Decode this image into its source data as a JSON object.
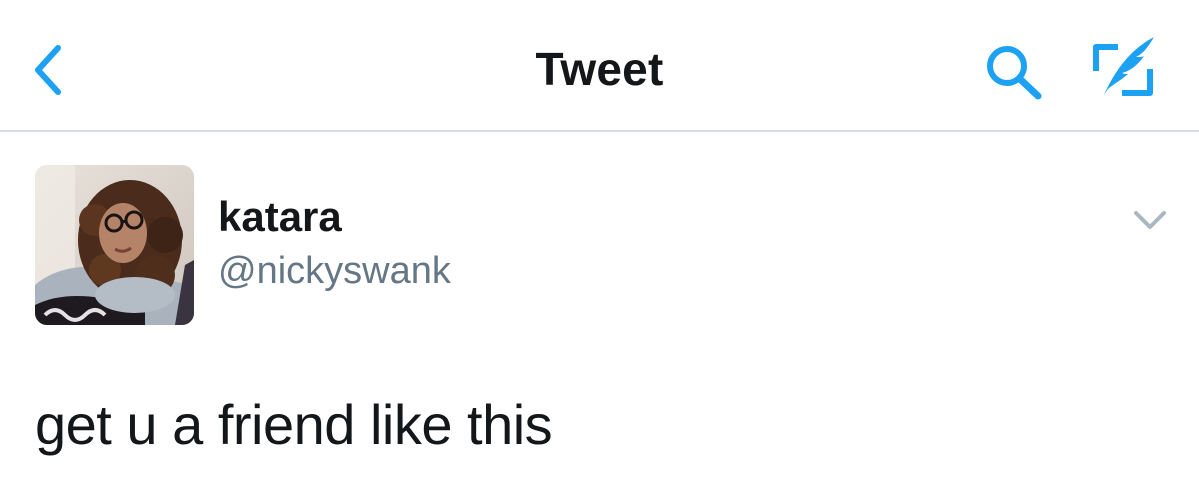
{
  "navbar": {
    "title": "Tweet",
    "back_icon": "chevron-left-icon",
    "search_icon": "search-icon",
    "compose_icon": "compose-tweet-icon"
  },
  "tweet": {
    "author": {
      "display_name": "katara",
      "handle": "@nickyswank"
    },
    "options_icon": "chevron-down-icon",
    "text": "get u a friend like this"
  },
  "colors": {
    "accent": "#1da1f2",
    "text_primary": "#14171a",
    "text_secondary": "#657786",
    "divider": "#d8dde2",
    "caret": "#aab8c2"
  }
}
